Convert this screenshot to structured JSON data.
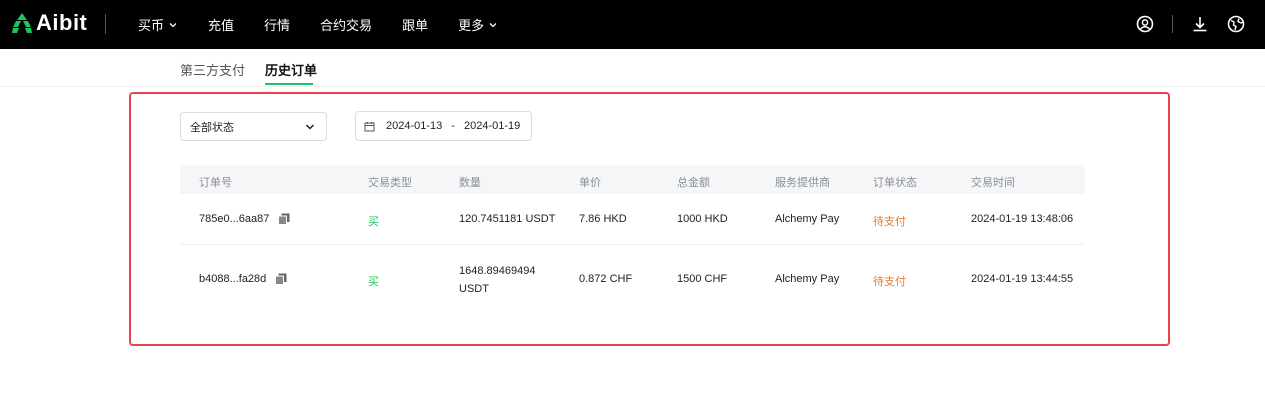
{
  "brand": {
    "name": "Aibit"
  },
  "nav": {
    "items": [
      {
        "label": "买币",
        "has_dropdown": true
      },
      {
        "label": "充值",
        "has_dropdown": false
      },
      {
        "label": "行情",
        "has_dropdown": false
      },
      {
        "label": "合约交易",
        "has_dropdown": false
      },
      {
        "label": "跟单",
        "has_dropdown": false
      },
      {
        "label": "更多",
        "has_dropdown": true
      }
    ],
    "right_icons": [
      "user-icon",
      "download-icon",
      "globe-icon"
    ]
  },
  "subtabs": {
    "items": [
      {
        "label": "第三方支付",
        "active": false
      },
      {
        "label": "历史订单",
        "active": true
      }
    ],
    "active_color": "#21c15d"
  },
  "filters": {
    "status": {
      "value": "全部状态"
    },
    "date_range": {
      "start": "2024-01-13",
      "separator": "-",
      "end": "2024-01-19"
    }
  },
  "table": {
    "columns": [
      "订单号",
      "交易类型",
      "数量",
      "单价",
      "总金额",
      "服务提供商",
      "订单状态",
      "交易时间"
    ],
    "rows": [
      {
        "order_id": "785e0...6aa87",
        "type": "买",
        "quantity": "120.7451181 USDT",
        "unit_price": "7.86 HKD",
        "total": "1000 HKD",
        "provider": "Alchemy Pay",
        "status": "待支付",
        "time": "2024-01-19 13:48:06"
      },
      {
        "order_id": "b4088...fa28d",
        "type": "买",
        "quantity": "1648.89469494 USDT",
        "unit_price": "0.872 CHF",
        "total": "1500 CHF",
        "provider": "Alchemy Pay",
        "status": "待支付",
        "time": "2024-01-19 13:44:55"
      }
    ]
  },
  "colors": {
    "buy": "#21c15d",
    "pending": "#f07a2a",
    "highlight_border": "#e8424a"
  }
}
